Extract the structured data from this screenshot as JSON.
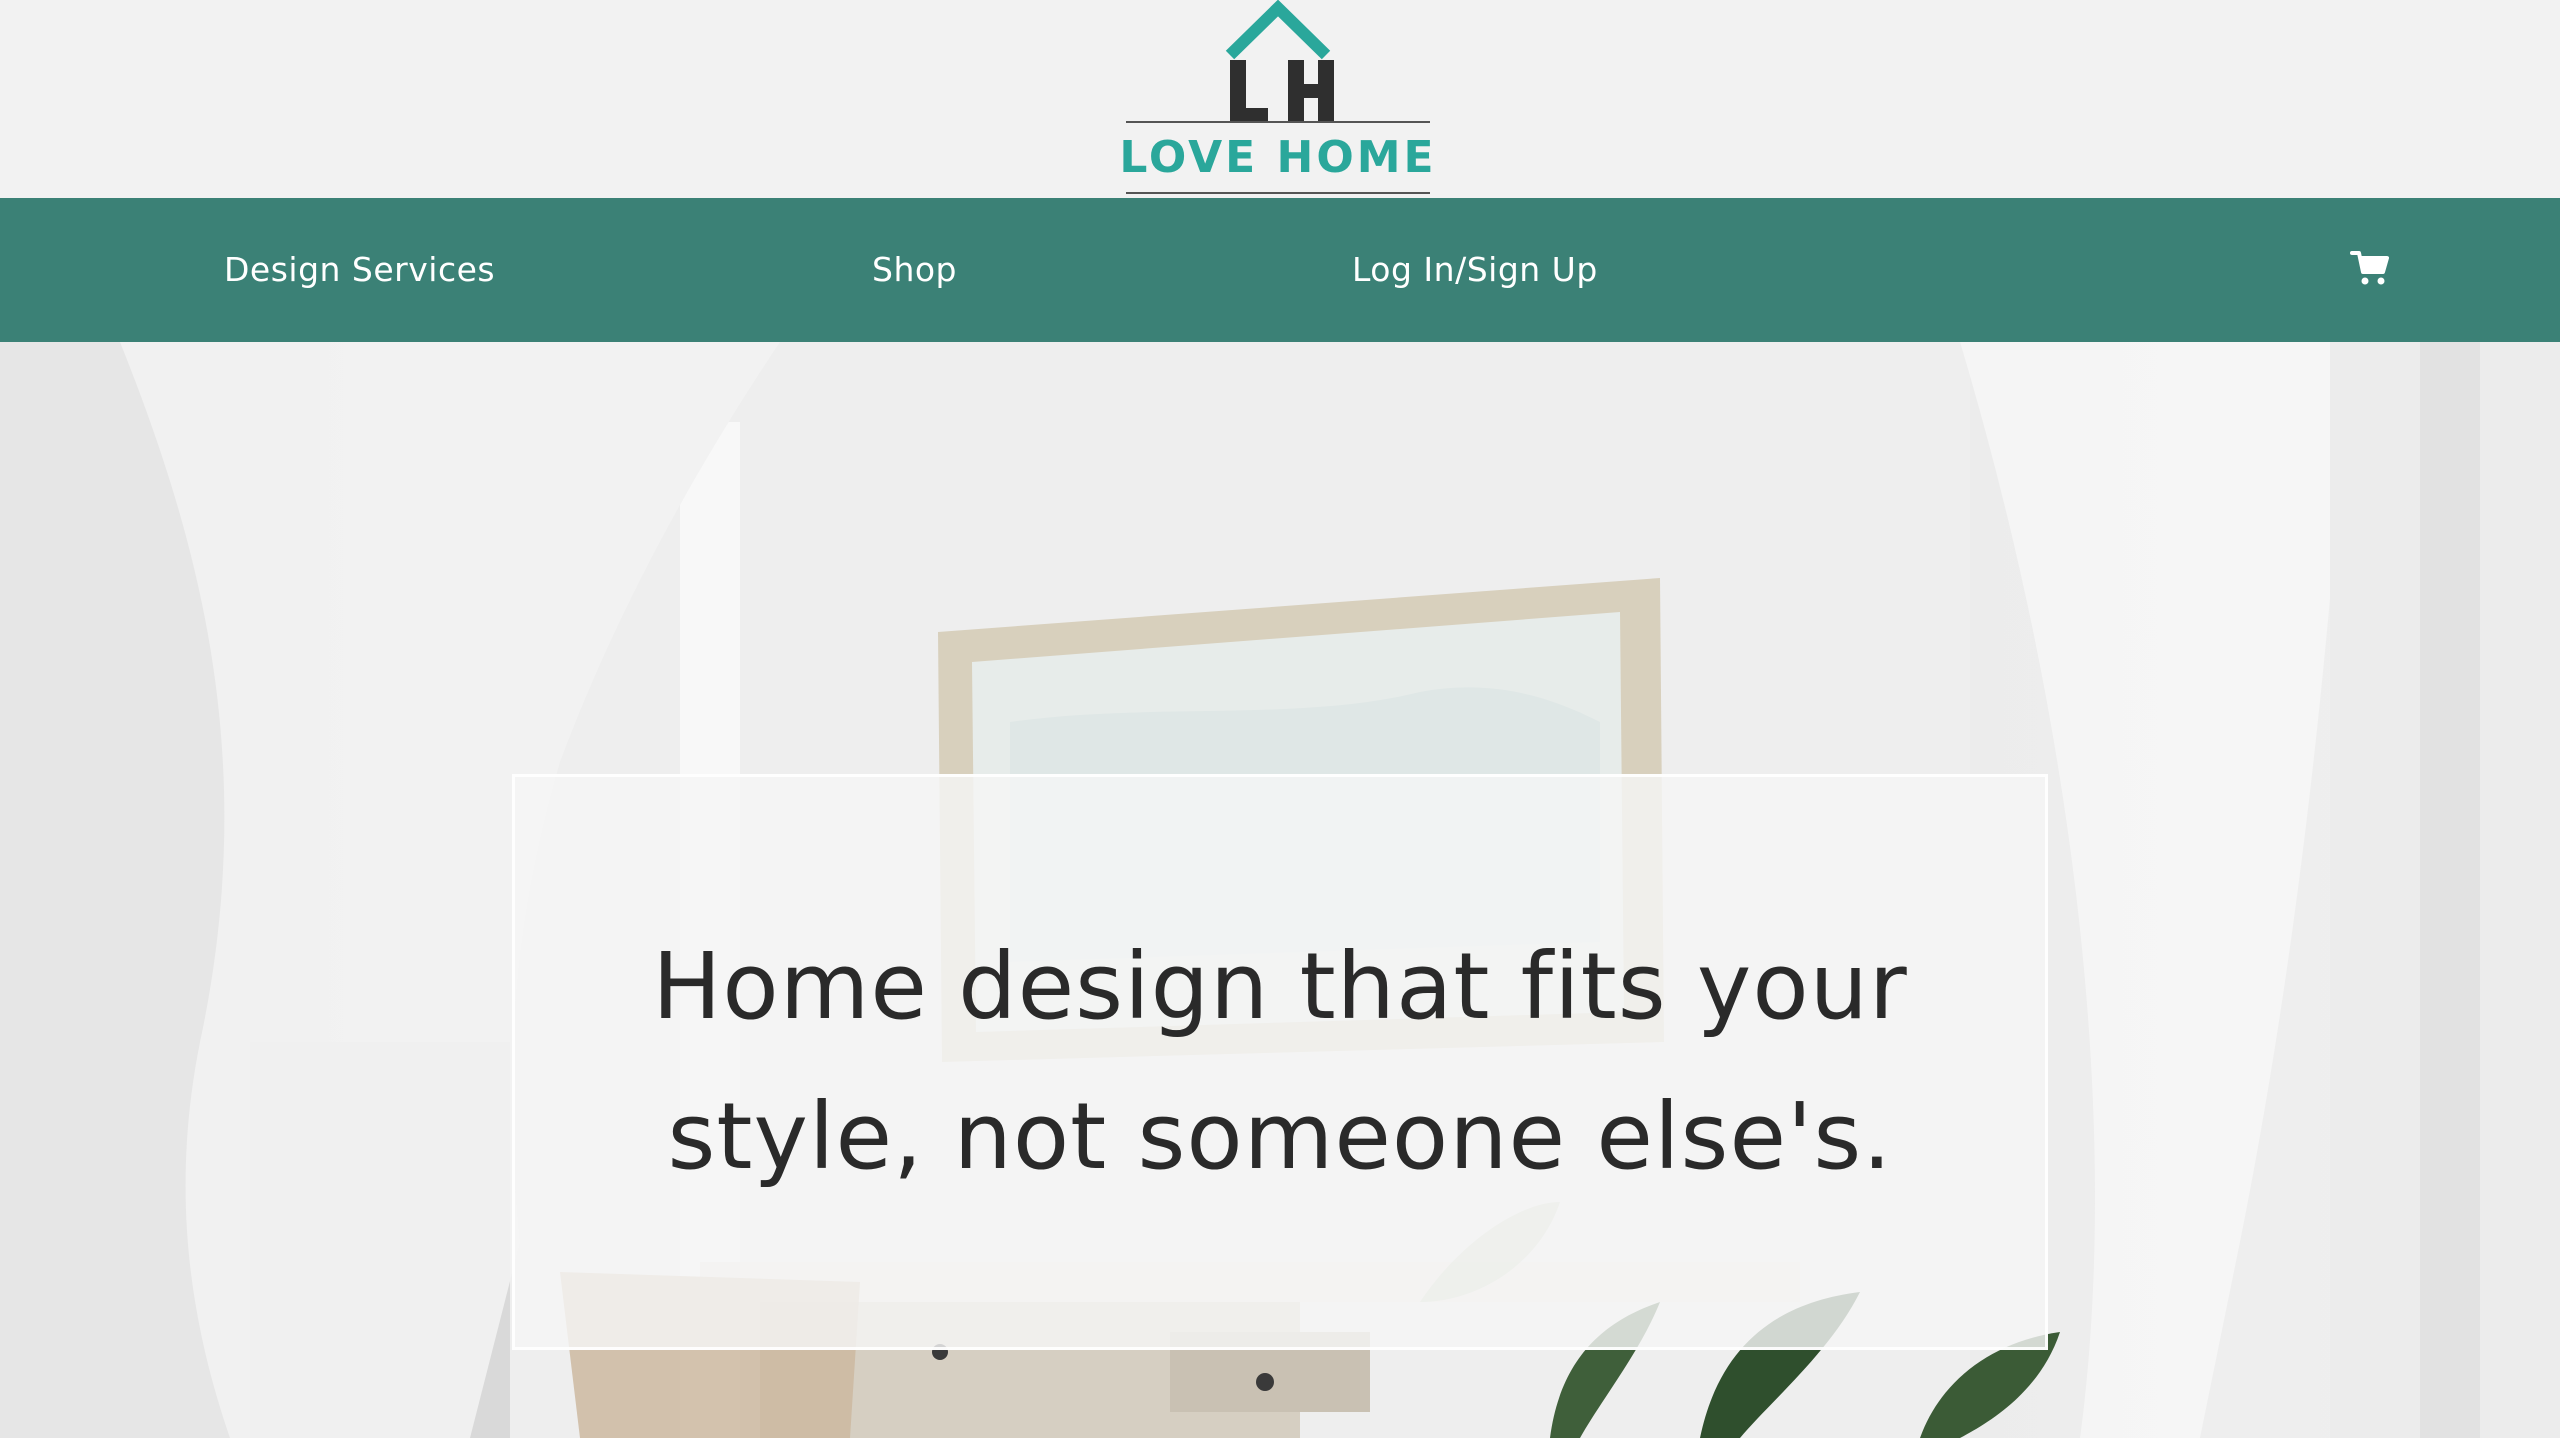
{
  "brand": {
    "monogram": "LH",
    "name": "LOVE HOME",
    "colors": {
      "teal": "#2aa79b",
      "dark": "#2f2f2f"
    }
  },
  "nav": {
    "items": [
      {
        "label": "Design Services"
      },
      {
        "label": "Shop"
      },
      {
        "label": "Log In/Sign Up"
      }
    ],
    "cart_icon": "cart-icon",
    "background": "#3b8176"
  },
  "hero": {
    "headline": "Home design that fits your style, not someone else's."
  }
}
